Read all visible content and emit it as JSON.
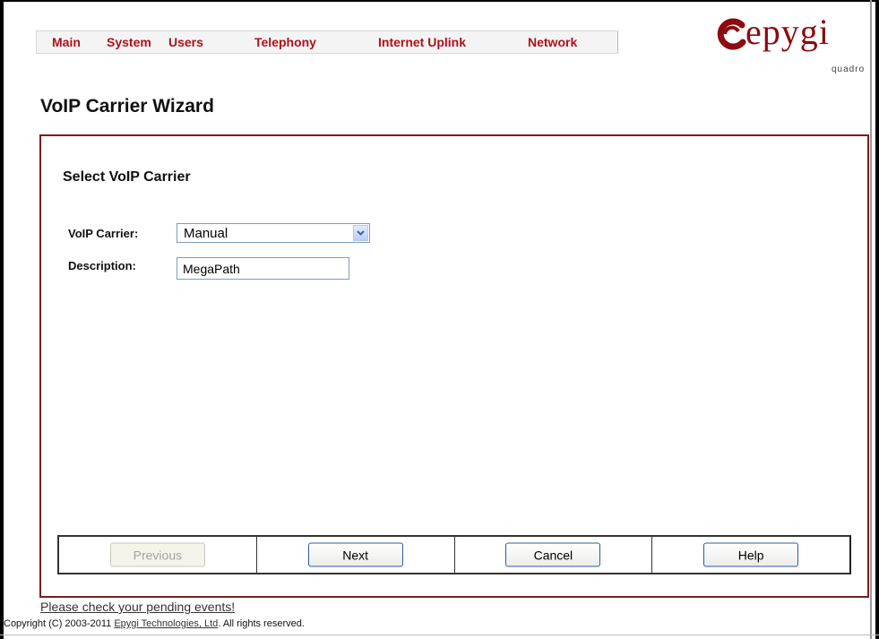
{
  "nav": {
    "items": [
      {
        "label": "Main"
      },
      {
        "label": "System"
      },
      {
        "label": "Users"
      },
      {
        "label": "Telephony"
      },
      {
        "label": "Internet Uplink"
      },
      {
        "label": "Network"
      }
    ]
  },
  "logo": {
    "text": "epygi",
    "sub": "quadro",
    "color": "#8b0b0f"
  },
  "page": {
    "title": "VoIP Carrier Wizard"
  },
  "form": {
    "heading": "Select VoIP Carrier",
    "carrier_label": "VoIP Carrier:",
    "carrier_value": "Manual",
    "description_label": "Description:",
    "description_value": "MegaPath"
  },
  "buttons": {
    "previous": "Previous",
    "next": "Next",
    "cancel": "Cancel",
    "help": "Help"
  },
  "footer": {
    "pending_link": "Please check your pending events!",
    "copyright_prefix": "Copyright (C) 2003-2011 ",
    "company_link": "Epygi Technologies, Ltd",
    "copyright_suffix": ". All rights reserved."
  },
  "colors": {
    "accent": "#b0101a",
    "panel_border": "#7a1e1e"
  }
}
